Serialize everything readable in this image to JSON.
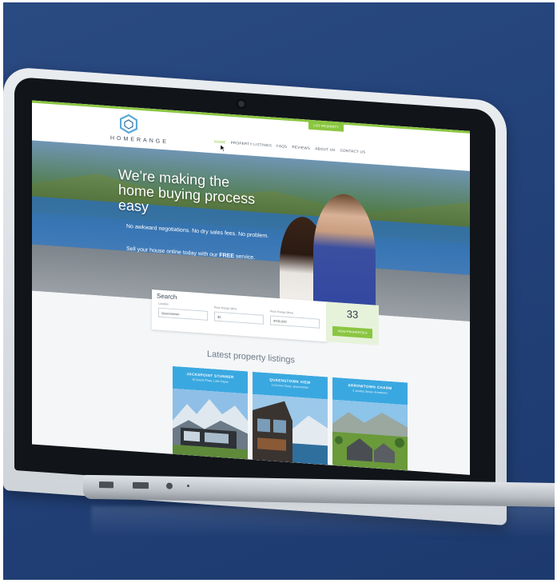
{
  "site": {
    "logo_text": "HOMERANGE",
    "cta_label": "LIST PROPERTY",
    "nav": [
      "HOME",
      "PROPERTY LISTINGS",
      "FAQS",
      "REVIEWS",
      "ABOUT US",
      "CONTACT US"
    ],
    "headline": "We're making the home buying process easy",
    "sub1": "No awkward negotiations. No dry sales fees. No problem.",
    "sub2_prefix": "Sell your house online today with our ",
    "sub2_bold": "FREE",
    "sub2_suffix": " service."
  },
  "search": {
    "title": "Search",
    "location_label": "Location",
    "location_value": "Queenstown",
    "min_label": "Price Range (Min)",
    "min_value": "$0",
    "max_label": "Price Range (Max)",
    "max_value": "$700,000",
    "count": "33",
    "view_button": "VIEW PROPERTIES"
  },
  "listings": {
    "heading": "Latest property listings",
    "cards": [
      {
        "title": "JACKSPOINT STUNNER",
        "sub": "19 Quartz Place, Lake Hayes"
      },
      {
        "title": "QUEENSTOWN VIEW",
        "sub": "13 Aurum Close, Queenstown"
      },
      {
        "title": "ARROWTOWN CHARM",
        "sub": "3 Jenkins Street, Arrowtown"
      }
    ]
  },
  "colors": {
    "accent": "#8ac640",
    "card_header": "#3aa8e0",
    "background": "#23427a"
  }
}
